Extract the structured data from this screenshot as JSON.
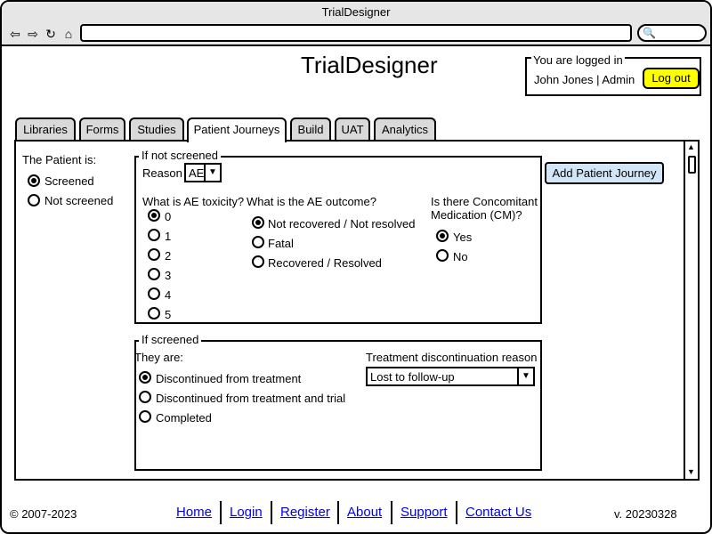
{
  "window": {
    "title": "TrialDesigner"
  },
  "browser": {
    "nav_icons": [
      "back-icon",
      "forward-icon",
      "reload-icon",
      "home-icon"
    ],
    "url_value": "",
    "search_value": ""
  },
  "header": {
    "app_title": "TrialDesigner",
    "login_legend": "You are logged in",
    "user": "John Jones | Admin",
    "logout_label": "Log out"
  },
  "tabs": [
    {
      "label": "Libraries"
    },
    {
      "label": "Forms"
    },
    {
      "label": "Studies"
    },
    {
      "label": "Patient Journeys",
      "active": true
    },
    {
      "label": "Build"
    },
    {
      "label": "UAT"
    },
    {
      "label": "Analytics"
    }
  ],
  "patient": {
    "heading": "The Patient is:",
    "options": [
      "Screened",
      "Not screened"
    ],
    "selected": "Screened"
  },
  "not_screened": {
    "legend": "If not screened",
    "reason_label": "Reason",
    "reason_value": "AE",
    "toxicity_question": "What is AE toxicity?",
    "toxicity_options": [
      "0",
      "1",
      "2",
      "3",
      "4",
      "5"
    ],
    "toxicity_selected": "0",
    "outcome_question": "What is the AE outcome?",
    "outcome_options": [
      "Not recovered / Not resolved",
      "Fatal",
      "Recovered / Resolved"
    ],
    "outcome_selected": "Not recovered / Not resolved",
    "cm_question_line1": "Is there Concomitant",
    "cm_question_line2": "Medication (CM)?",
    "cm_options": [
      "Yes",
      "No"
    ],
    "cm_selected": "Yes"
  },
  "screened": {
    "legend": "If screened",
    "they_are_label": "They are:",
    "options": [
      "Discontinued from treatment",
      "Discontinued from treatment and trial",
      "Completed"
    ],
    "selected": "Discontinued from treatment",
    "discontinuation_label": "Treatment discontinuation reason",
    "discontinuation_value": "Lost to follow-up"
  },
  "actions": {
    "add_journey_label": "Add Patient Journey"
  },
  "footer": {
    "copyright": "© 2007-2023",
    "links": [
      "Home",
      "Login",
      "Register",
      "About",
      "Support",
      "Contact Us"
    ],
    "version": "v. 20230328"
  }
}
